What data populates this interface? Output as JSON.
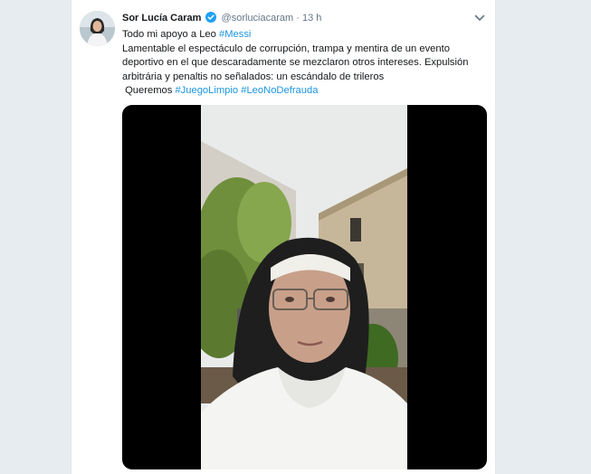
{
  "tweet": {
    "author_name": "Sor Lucía Caram",
    "author_handle": "@sorluciacaram",
    "separator": "·",
    "timestamp": "13 h",
    "lines": [
      {
        "text": "Todo mi apoyo a Leo ",
        "tag": "#Messi"
      },
      {
        "text": "Lamentable el espectáculo de corrupción, trampa y mentira de un evento deportivo en el que descaradamente se mezclaron otros intereses. Expulsión arbitrária y penaltis no señalados: un escándalo de trileros"
      },
      {
        "prefix": " Queremos ",
        "tag1": "#JuegoLimpio",
        "sep": " ",
        "tag2": "#LeoNoDefrauda"
      }
    ]
  },
  "colors": {
    "background": "#e6ecf0",
    "card": "#ffffff",
    "link": "#1b95e0",
    "verified": "#1da1f2",
    "muted": "#657786"
  },
  "icons": {
    "verified": "verified-badge-icon",
    "menu": "chevron-down-icon"
  }
}
